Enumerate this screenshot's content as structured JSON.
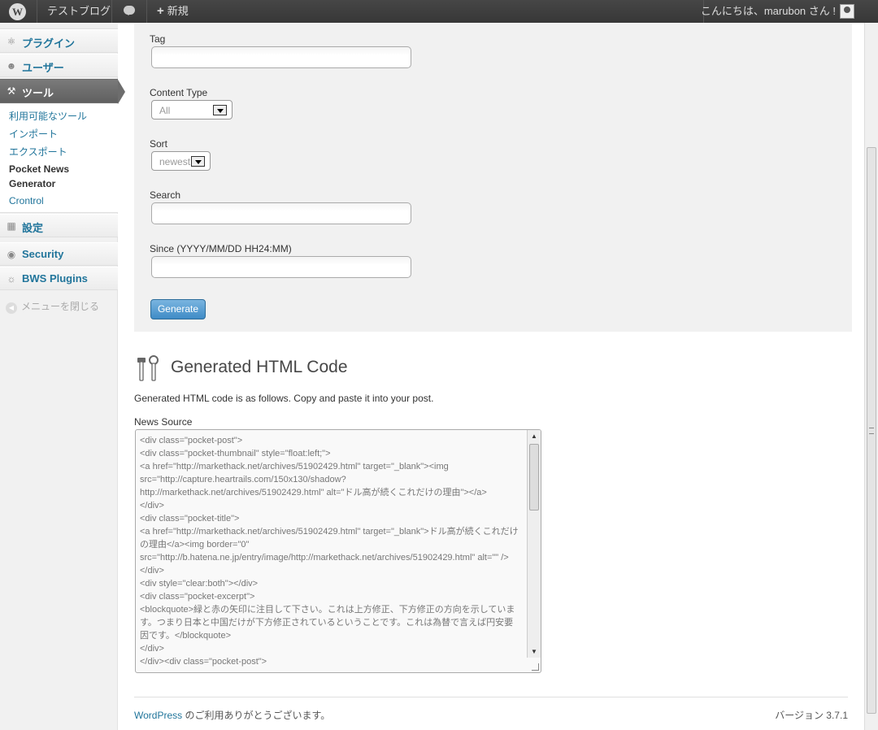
{
  "adminbar": {
    "wp_logo": "W",
    "site_name": "テストブログ",
    "new_plus": "+",
    "new_label": "新規",
    "greeting": "こんにちは、marubon さん !"
  },
  "sidebar": {
    "plugins": "プラグイン",
    "users": "ユーザー",
    "tools": "ツール",
    "tools_sub": [
      "利用可能なツール",
      "インポート",
      "エクスポート",
      "Pocket News Generator",
      "Crontrol"
    ],
    "settings": "設定",
    "security": "Security",
    "bws": "BWS Plugins",
    "collapse": "メニューを閉じる"
  },
  "form": {
    "tag_label": "Tag",
    "content_type_label": "Content Type",
    "content_type_value": "All",
    "sort_label": "Sort",
    "sort_value": "newest",
    "search_label": "Search",
    "since_label": "Since (YYYY/MM/DD HH24:MM)",
    "generate_button": "Generate"
  },
  "generated": {
    "title": "Generated HTML Code",
    "description": "Generated HTML code is as follows. Copy and paste it into your post.",
    "news_source_label": "News Source",
    "code": "<div class=\"pocket-post\">\n<div class=\"pocket-thumbnail\" style=\"float:left;\">\n<a href=\"http://markethack.net/archives/51902429.html\" target=\"_blank\"><img src=\"http://capture.heartrails.com/150x130/shadow?http://markethack.net/archives/51902429.html\" alt=\"ドル高が続くこれだけの理由\"></a>\n</div>\n<div class=\"pocket-title\">\n<a href=\"http://markethack.net/archives/51902429.html\" target=\"_blank\">ドル高が続くこれだけの理由</a><img border=\"0\" src=\"http://b.hatena.ne.jp/entry/image/http://markethack.net/archives/51902429.html\" alt=\"\" />\n</div>\n<div style=\"clear:both\"></div>\n<div class=\"pocket-excerpt\">\n<blockquote>緑と赤の矢印に注目して下さい。これは上方修正、下方修正の方向を示しています。つまり日本と中国だけが下方修正されているということです。これは為替で言えば円安要因です。</blockquote>\n</div>\n</div><div class=\"pocket-post\">"
  },
  "footer": {
    "wp_link": "WordPress",
    "thanks": " のご利用ありがとうございます。",
    "version": "バージョン 3.7.1"
  }
}
